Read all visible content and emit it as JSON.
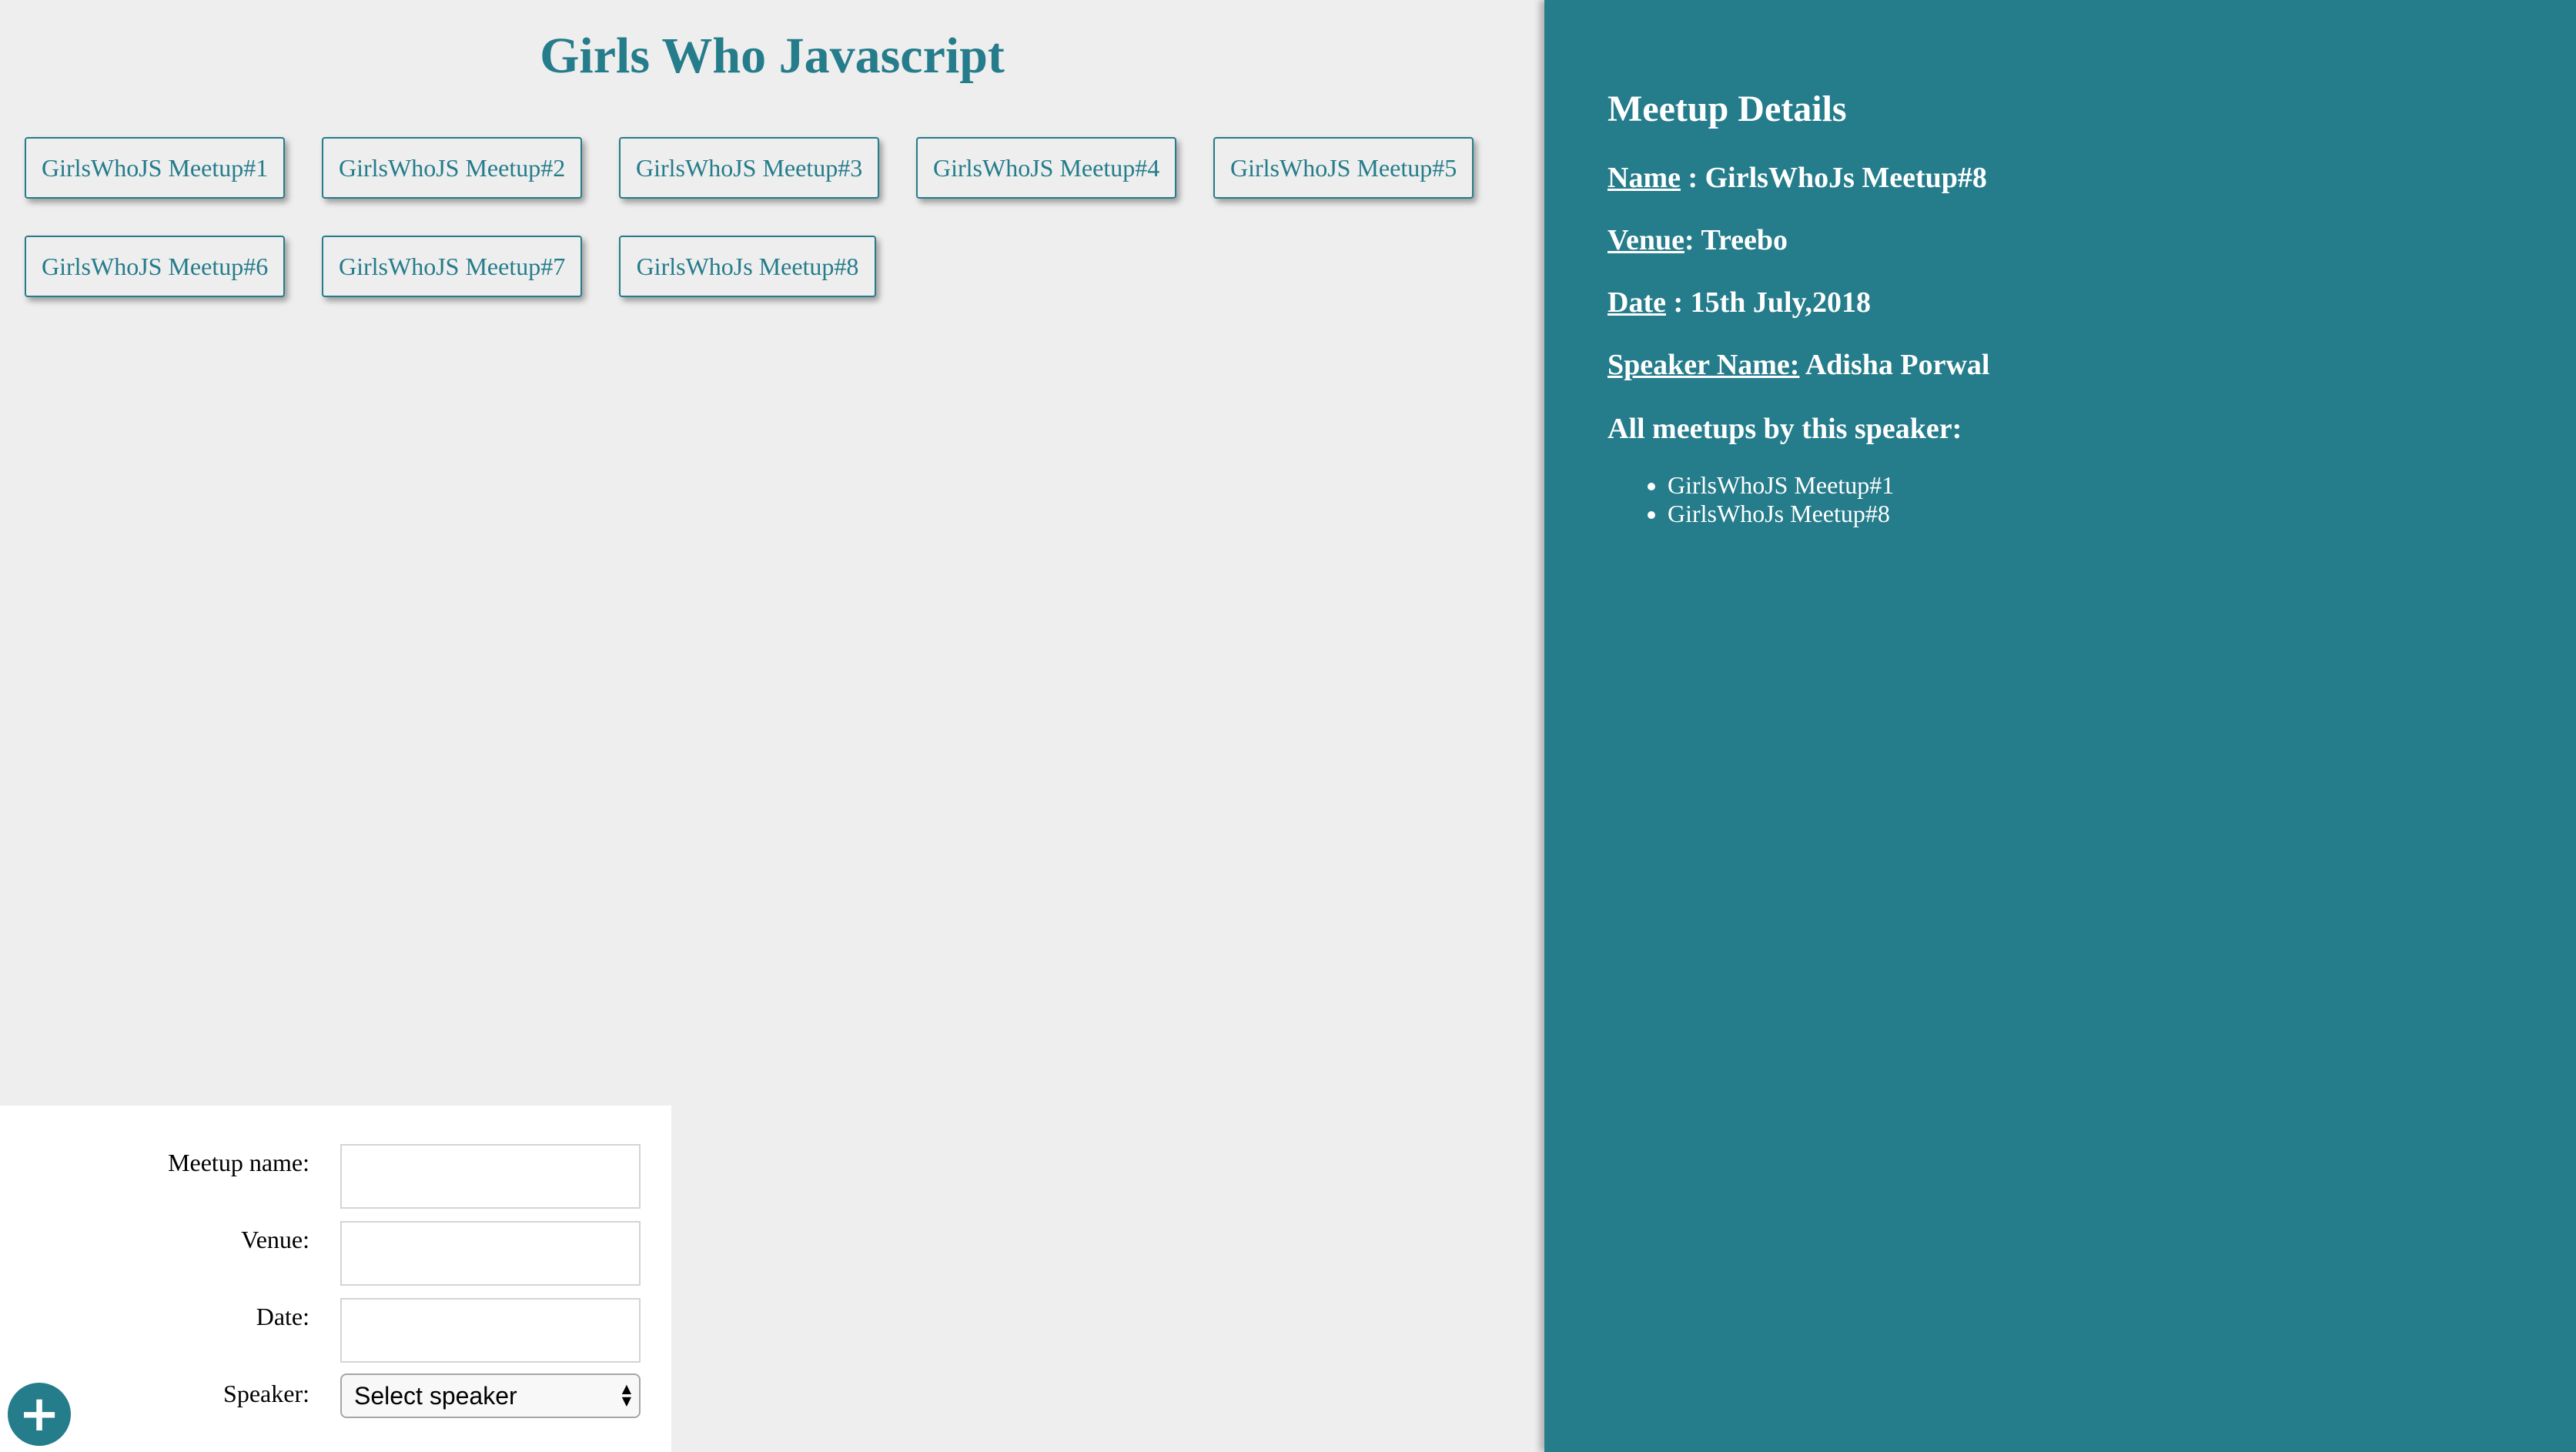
{
  "app": {
    "title": "Girls Who Javascript"
  },
  "meetups": [
    "GirlsWhoJS Meetup#1",
    "GirlsWhoJS Meetup#2",
    "GirlsWhoJS Meetup#3",
    "GirlsWhoJS Meetup#4",
    "GirlsWhoJS Meetup#5",
    "GirlsWhoJS Meetup#6",
    "GirlsWhoJS Meetup#7",
    "GirlsWhoJs Meetup#8"
  ],
  "form": {
    "meetup_name_label": "Meetup name:",
    "meetup_name_value": "",
    "venue_label": "Venue:",
    "venue_value": "",
    "date_label": "Date:",
    "date_value": "",
    "speaker_label": "Speaker:",
    "speaker_selected": "Select speaker",
    "add_icon": "plus-icon",
    "add_glyph": "+"
  },
  "details": {
    "heading": "Meetup Details",
    "name_key": "Name",
    "name_sep": " : ",
    "name_value": "GirlsWhoJs Meetup#8",
    "venue_key": "Venue",
    "venue_sep": ": ",
    "venue_value": "Treebo",
    "date_key": "Date",
    "date_sep": " : ",
    "date_value": "15th July,2018",
    "speaker_key": "Speaker Name:",
    "speaker_sep": " ",
    "speaker_value": "Adisha Porwal",
    "all_meetups_label": "All meetups by this speaker:",
    "speaker_meetups": [
      "GirlsWhoJS Meetup#1",
      "GirlsWhoJs Meetup#8"
    ]
  },
  "colors": {
    "accent": "#257c8b",
    "background": "#eeeeee",
    "panel": "#ffffff"
  }
}
